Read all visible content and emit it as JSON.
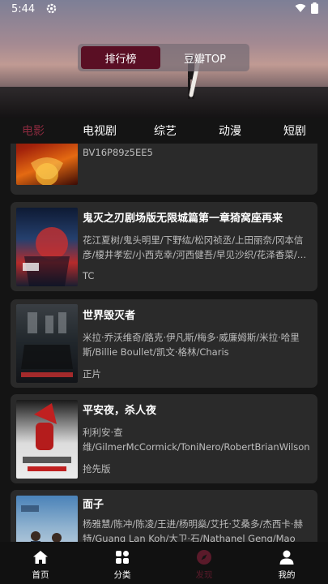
{
  "status_bar": {
    "time": "5:44"
  },
  "ranking_toggle": {
    "active_label": "排行榜",
    "inactive_label": "豆瓣TOP"
  },
  "category_tabs": [
    {
      "label": "电影",
      "active": true
    },
    {
      "label": "电视剧",
      "active": false
    },
    {
      "label": "综艺",
      "active": false
    },
    {
      "label": "动漫",
      "active": false
    },
    {
      "label": "短剧",
      "active": false
    }
  ],
  "movies": [
    {
      "title": "",
      "cast": "",
      "tag": "BV16P89z5EE5"
    },
    {
      "title": "鬼灭之刃剧场版无限城篇第一章猗窝座再来",
      "cast": "花江夏树/鬼头明里/下野纮/松冈祯丞/上田丽奈/冈本信彦/榎井孝宏/小西克幸/河西健吾/早见沙织/花泽香菜/…",
      "tag": "TC"
    },
    {
      "title": "世界毁灭者",
      "cast": "米拉·乔沃维奇/路克·伊凡斯/梅多·威廉姆斯/米拉·哈里斯/Billie Boullet/凯文·格林/Charis Agbonlahor/Steven…",
      "tag": "正片"
    },
    {
      "title": "平安夜，杀人夜",
      "cast": "利利安·查维/GilmerMcCormick/ToniNero/RobertBrianWilson",
      "tag": "抢先版"
    },
    {
      "title": "面子",
      "cast": "杨雅慧/陈冲/陈凌/王进/杨明燊/艾托·艾桑多/杰西卡·赫特/Guang Lan Koh/大卫·石/Nathanel Geng/Mao Zhao…",
      "tag": ""
    }
  ],
  "bottom_nav": [
    {
      "label": "首页",
      "icon": "home-icon",
      "active": false
    },
    {
      "label": "分类",
      "icon": "grid-icon",
      "active": false
    },
    {
      "label": "发现",
      "icon": "compass-icon",
      "active": true
    },
    {
      "label": "我的",
      "icon": "user-icon",
      "active": false
    }
  ],
  "colors": {
    "accent": "#5a0f24",
    "active_tab": "#8a2a3e",
    "card_bg": "#2a2a2a",
    "page_bg": "#141414"
  }
}
